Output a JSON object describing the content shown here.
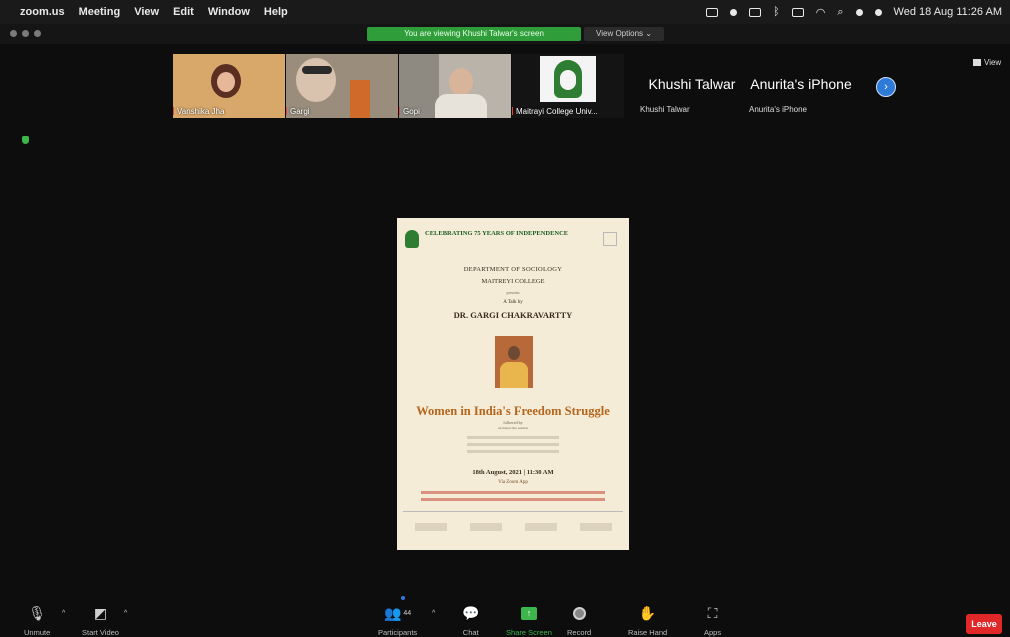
{
  "menubar": {
    "app": "zoom.us",
    "items": [
      "Meeting",
      "View",
      "Edit",
      "Window",
      "Help"
    ],
    "clock": "Wed 18 Aug 11:26 AM"
  },
  "share_banner": {
    "text": "You are viewing Khushi Talwar's screen",
    "view_options": "View Options ⌄"
  },
  "participants": [
    {
      "name": "Vanshika Jha"
    },
    {
      "name": "Gargi"
    },
    {
      "name": "Gopi"
    },
    {
      "name": "Maitrayi College Univ..."
    },
    {
      "display": "Khushi Talwar",
      "name": "Khushi Talwar"
    },
    {
      "display": "Anurita's iPhone",
      "name": "Anurita's iPhone"
    }
  ],
  "view_button": "View",
  "poster": {
    "celebrating": "CELEBRATING 75 YEARS OF INDEPENDENCE",
    "department": "DEPARTMENT OF SOCIOLOGY",
    "college": "MAITREYI COLLEGE",
    "presents": "presents",
    "talk_by": "A Talk by",
    "speaker": "DR. GARGI CHAKRAVARTTY",
    "title": "Women in India's Freedom Struggle",
    "followed_by": "followed by",
    "followed_by_2": "an interactive session",
    "date": "18th August, 2021 | 11:30 AM",
    "platform": "Via Zoom App"
  },
  "toolbar": {
    "unmute": "Unmute",
    "start_video": "Start Video",
    "participants": "Participants",
    "participant_count": "44",
    "chat": "Chat",
    "share_screen": "Share Screen",
    "record": "Record",
    "raise_hand": "Raise Hand",
    "apps": "Apps",
    "leave": "Leave"
  }
}
